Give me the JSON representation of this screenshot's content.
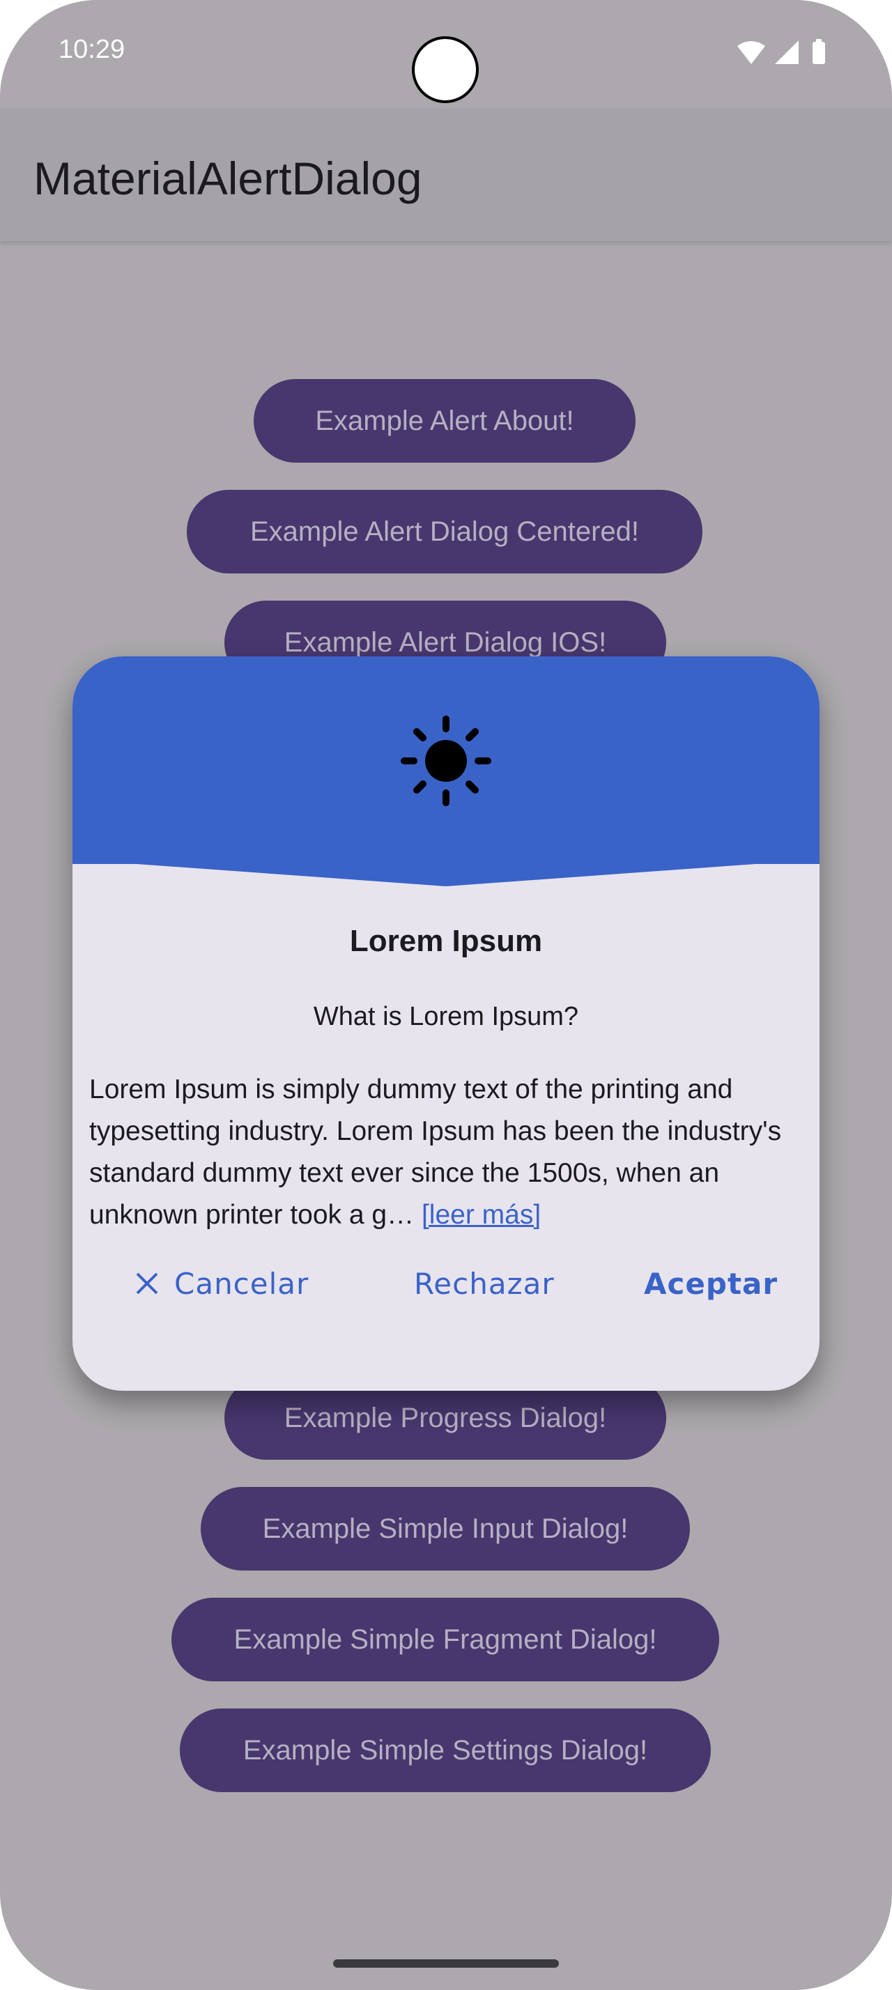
{
  "status_bar": {
    "time": "10:29",
    "icons": [
      "wifi-icon",
      "signal-icon",
      "battery-icon"
    ]
  },
  "app_bar": {
    "title": "MaterialAlertDialog"
  },
  "buttons": [
    {
      "label": "Example Alert About!"
    },
    {
      "label": "Example Alert Dialog Centered!"
    },
    {
      "label": "Example Alert Dialog IOS!"
    },
    {
      "label": "Example Progress Dialog!"
    },
    {
      "label": "Example Simple Input Dialog!"
    },
    {
      "label": "Example Simple Fragment Dialog!"
    },
    {
      "label": "Example Simple Settings Dialog!"
    }
  ],
  "dialog": {
    "header_icon": "sun-icon",
    "title": "Lorem Ipsum",
    "subtitle": "What is Lorem Ipsum?",
    "body": "Lorem Ipsum is simply dummy text of the printing and typesetting industry. Lorem Ipsum has been the industry's standard dummy text ever since the 1500s, when an unknown printer took a g…",
    "read_more": "[leer más]",
    "actions": {
      "cancel": "Cancelar",
      "reject": "Rechazar",
      "accept": "Aceptar"
    }
  },
  "colors": {
    "background": "#aca8ad",
    "button": "#47376e",
    "button_text": "#b6b0c2",
    "dialog_header": "#3a63c8",
    "dialog_surface": "#e8e4ee",
    "accent": "#3a63c8"
  }
}
